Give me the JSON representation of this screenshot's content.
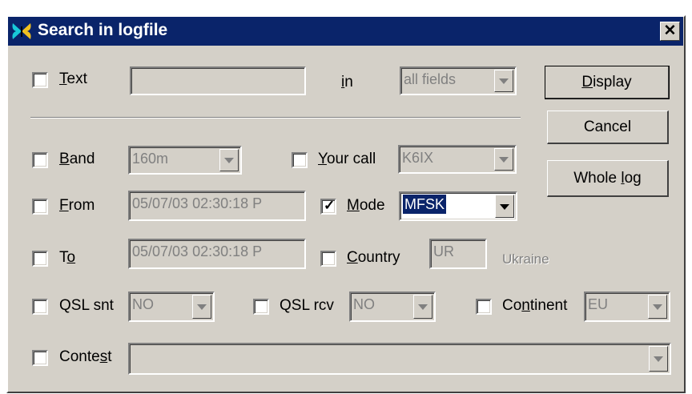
{
  "window": {
    "title": "Search in logfile",
    "close_label": "✕",
    "title_icon": "butterfly-app-icon"
  },
  "text_row": {
    "label_mnemonic": "T",
    "label_rest": "ext",
    "checked": false,
    "value": "",
    "in_mnemonic": "i",
    "in_rest": "n",
    "fields_select": "all fields"
  },
  "band_row": {
    "label_mnemonic": "B",
    "label_rest": "and",
    "checked": false,
    "value": "160m",
    "yourcall_mnemonic": "Y",
    "yourcall_rest": "our call",
    "yourcall_checked": false,
    "yourcall_value": "K6IX"
  },
  "from_row": {
    "label_mnemonic": "F",
    "label_rest": "rom",
    "checked": false,
    "value": "05/07/03 02:30:18 P",
    "mode_mnemonic": "M",
    "mode_rest": "ode",
    "mode_checked": true,
    "mode_value": "MFSK"
  },
  "to_row": {
    "label_prefix": "T",
    "label_mnemonic": "o",
    "checked": false,
    "value": "05/07/03 02:30:18 P",
    "country_mnemonic": "C",
    "country_rest": "ountry",
    "country_checked": false,
    "country_value": "UR",
    "country_name": "Ukraine"
  },
  "qsl_row": {
    "snt_label": "QSL snt",
    "snt_checked": false,
    "snt_value": "NO",
    "rcv_label": "QSL rcv",
    "rcv_checked": false,
    "rcv_value": "NO",
    "continent_prefix": "Co",
    "continent_mnemonic": "n",
    "continent_rest": "tinent",
    "continent_checked": false,
    "continent_value": "EU"
  },
  "contest_row": {
    "label_prefix": "Conte",
    "label_mnemonic": "s",
    "label_rest": "t",
    "checked": false,
    "value": ""
  },
  "buttons": {
    "display_mnemonic": "D",
    "display_rest": "isplay",
    "cancel": "Cancel",
    "wholelog_prefix": "Whole ",
    "wholelog_mnemonic": "l",
    "wholelog_rest": "og"
  }
}
